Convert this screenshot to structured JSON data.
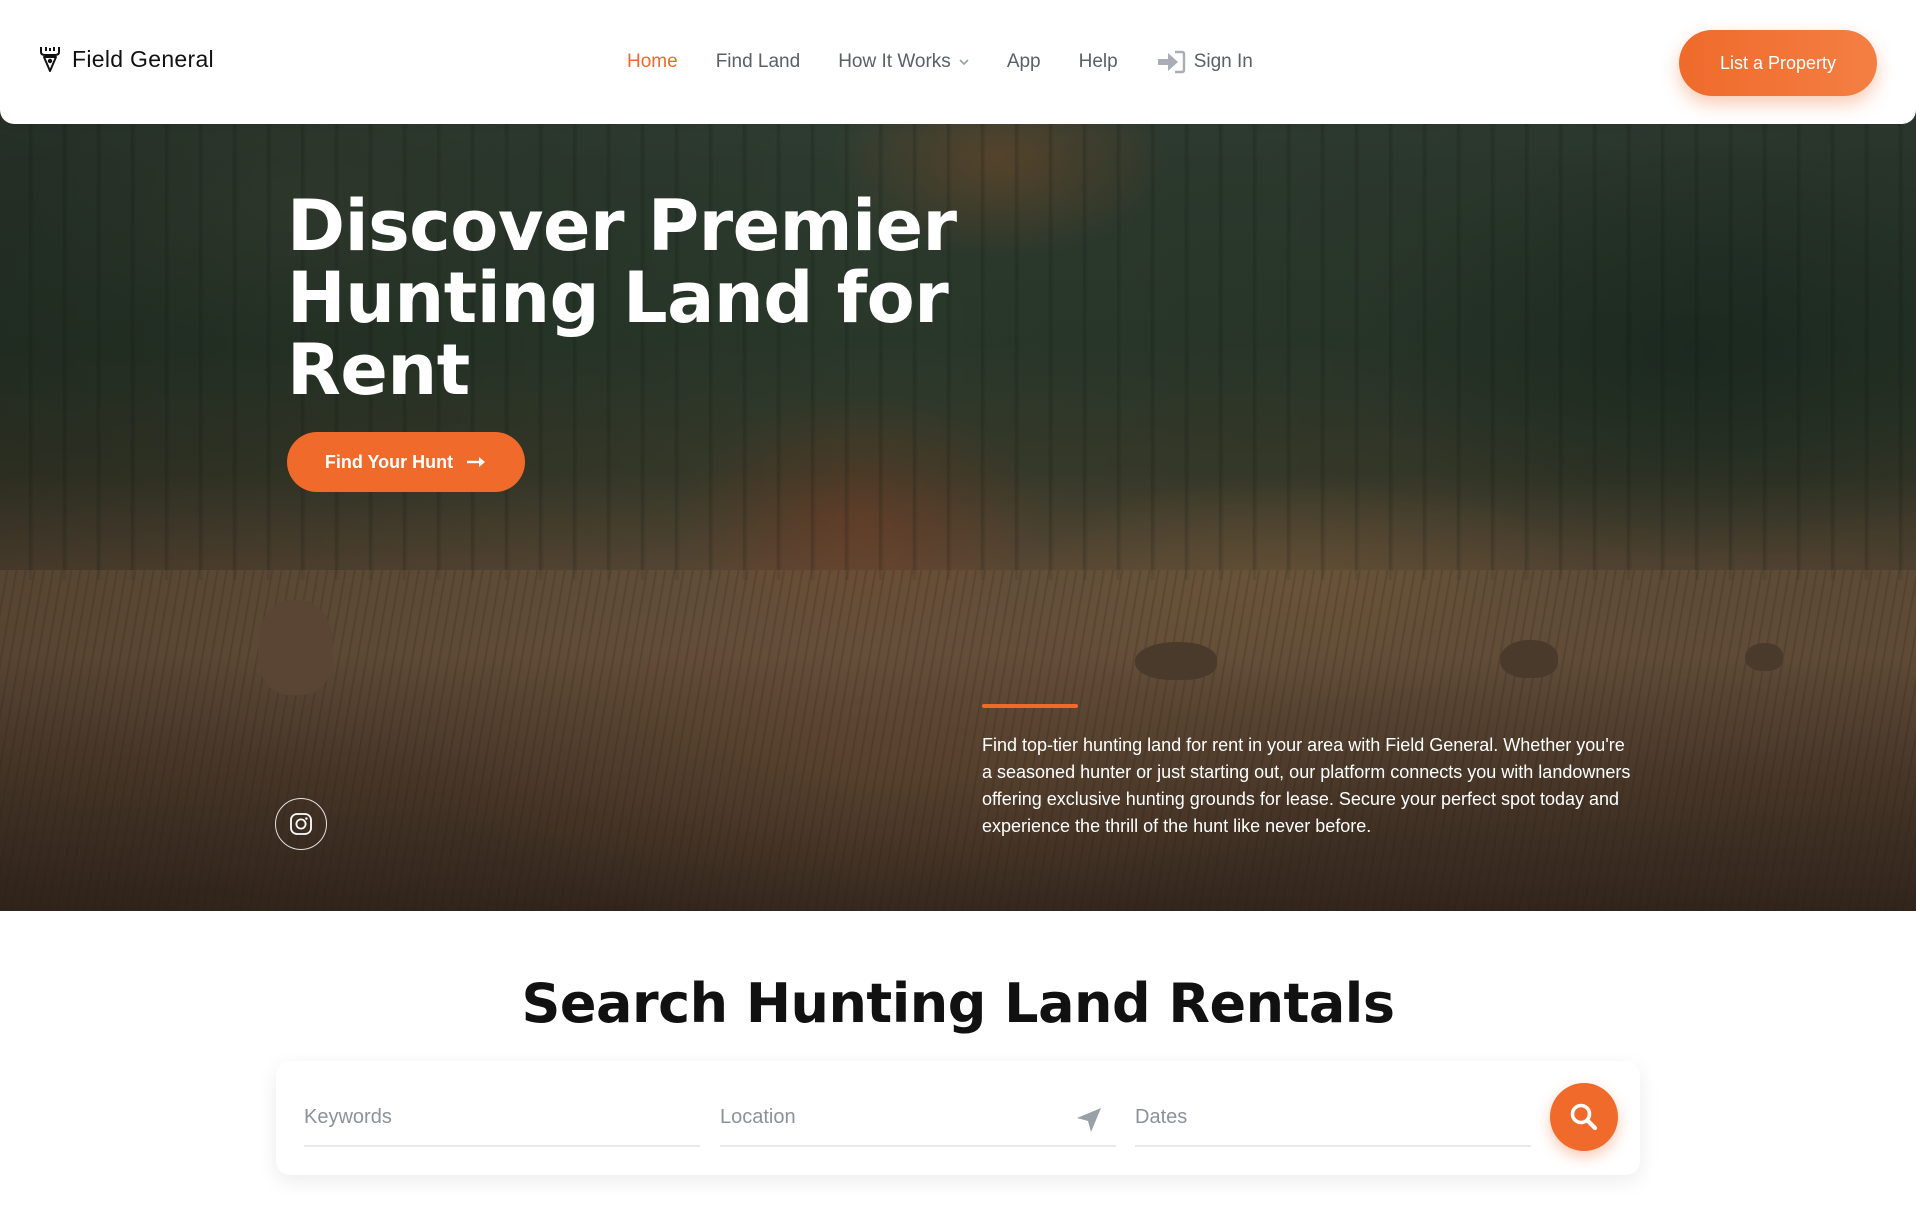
{
  "brand": {
    "name": "Field General",
    "icon": "antler-pin-icon"
  },
  "nav": {
    "items": [
      {
        "label": "Home",
        "active": true
      },
      {
        "label": "Find Land"
      },
      {
        "label": "How It Works",
        "icon": "chevron-down-icon"
      },
      {
        "label": "App"
      },
      {
        "label": "Help"
      }
    ],
    "signin": {
      "label": "Sign In",
      "icon": "sign-in-icon"
    },
    "cta": "List a Property"
  },
  "hero": {
    "title": "Discover Premier Hunting Land for Rent",
    "button": "Find Your Hunt",
    "button_icon": "arrow-right-icon",
    "description": "Find top-tier hunting land for rent in your area with Field General. Whether you're a seasoned hunter or just starting out, our platform connects you with landowners offering exclusive hunting grounds for lease. Secure your perfect spot today and experience the thrill of the hunt like never before.",
    "social_icon": "instagram-icon"
  },
  "search": {
    "title": "Search Hunting Land Rentals",
    "keywords_placeholder": "Keywords",
    "location_placeholder": "Location",
    "dates_placeholder": "Dates",
    "location_icon": "navigation-arrow-icon",
    "search_icon": "search-icon"
  },
  "colors": {
    "accent": "#ef6a2b",
    "text": "#1a1a1a",
    "muted": "#5b5f66"
  }
}
